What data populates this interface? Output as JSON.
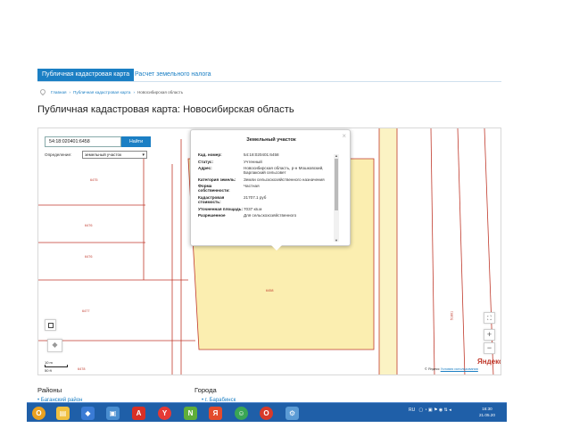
{
  "tabs": [
    {
      "label": "Публичная кадастровая карта",
      "active": true
    },
    {
      "label": "Расчет земельного налога",
      "active": false
    }
  ],
  "breadcrumb": [
    "Главная",
    "Публичная кадастровая карта",
    "Новосибирская область"
  ],
  "page_title": "Публичная кадастровая карта: Новосибирская область",
  "search": {
    "value": "54:18:020401:6458",
    "button": "Найти"
  },
  "definition": {
    "label": "Определение:",
    "selected": "земельный участок"
  },
  "parcel_labels": [
    "6475",
    "6476",
    "6476",
    "6477",
    "6478",
    "6458",
    "51801"
  ],
  "popup": {
    "title": "Земельный участок",
    "rows": [
      {
        "key": "Кад. номер:",
        "value": "54:18:020401:6458"
      },
      {
        "key": "Статус:",
        "value": "Учтенный"
      },
      {
        "key": "Адрес:",
        "value": "Новосибирская область, р-н Мошковский, Барлакский сельсовет"
      },
      {
        "key": "Категория земель:",
        "value": "Земли сельскохозяйственного назначения"
      },
      {
        "key": "Форма собственности:",
        "value": "Частная"
      },
      {
        "key": "Кадастровая стоимость:",
        "value": "21707.1 руб"
      },
      {
        "key": "Уточненная площадь:",
        "value": "7037 кв.м"
      },
      {
        "key": "Разрешенное",
        "value": "Для сельскохозяйственного"
      }
    ]
  },
  "scale": {
    "top": "10 m",
    "bottom": "50 ft"
  },
  "copyright": {
    "prefix": "© Яндекс",
    "link": "Условия использования"
  },
  "yandex_logo": "Яндекс",
  "sections": {
    "left": "Районы",
    "right": "Города",
    "left_link": "Баганский район",
    "right_link": "г. Барабинск"
  },
  "taskbar": {
    "tray": "RU",
    "time": "16:30",
    "date": "21.05.20"
  },
  "colors": {
    "accent": "#1b7fc4",
    "parcel_fill": "#fbeeb0",
    "boundary": "#c0392b",
    "taskbar": "#1f5fa8"
  }
}
